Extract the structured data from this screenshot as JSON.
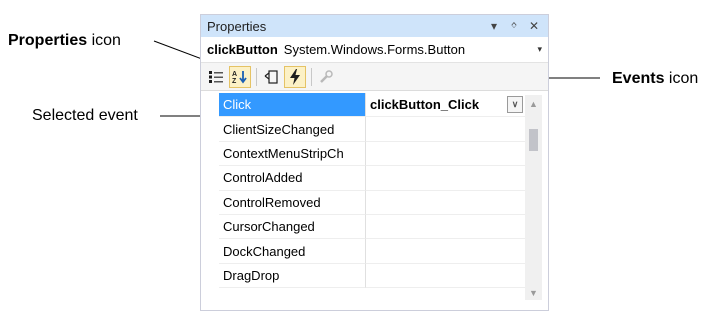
{
  "callouts": {
    "properties_bold": "Properties",
    "properties_rest": " icon",
    "events_bold": "Events",
    "events_rest": " icon",
    "selected_event": "Selected event"
  },
  "panel": {
    "title": "Properties",
    "title_buttons": [
      "▾",
      "ᛜ",
      "✕"
    ],
    "selector": {
      "name": "clickButton",
      "type": "System.Windows.Forms.Button",
      "arrow": "▾"
    },
    "toolbar": [
      {
        "name": "categorized-icon"
      },
      {
        "name": "alphabetical-icon"
      },
      {
        "name": "properties-icon"
      },
      {
        "name": "events-icon"
      },
      {
        "name": "property-pages-icon"
      }
    ],
    "rows": [
      {
        "name": "Click",
        "value": "clickButton_Click",
        "selected": true
      },
      {
        "name": "ClientSizeChanged",
        "value": ""
      },
      {
        "name": "ContextMenuStripCh",
        "value": ""
      },
      {
        "name": "ControlAdded",
        "value": ""
      },
      {
        "name": "ControlRemoved",
        "value": ""
      },
      {
        "name": "CursorChanged",
        "value": ""
      },
      {
        "name": "DockChanged",
        "value": ""
      },
      {
        "name": "DragDrop",
        "value": ""
      }
    ],
    "scroll": {
      "up": "▲",
      "down": "▼"
    }
  },
  "colors": {
    "titlebar": "#cfe4fa",
    "selection": "#3399ff",
    "active_tool": "#fcf1c6"
  }
}
